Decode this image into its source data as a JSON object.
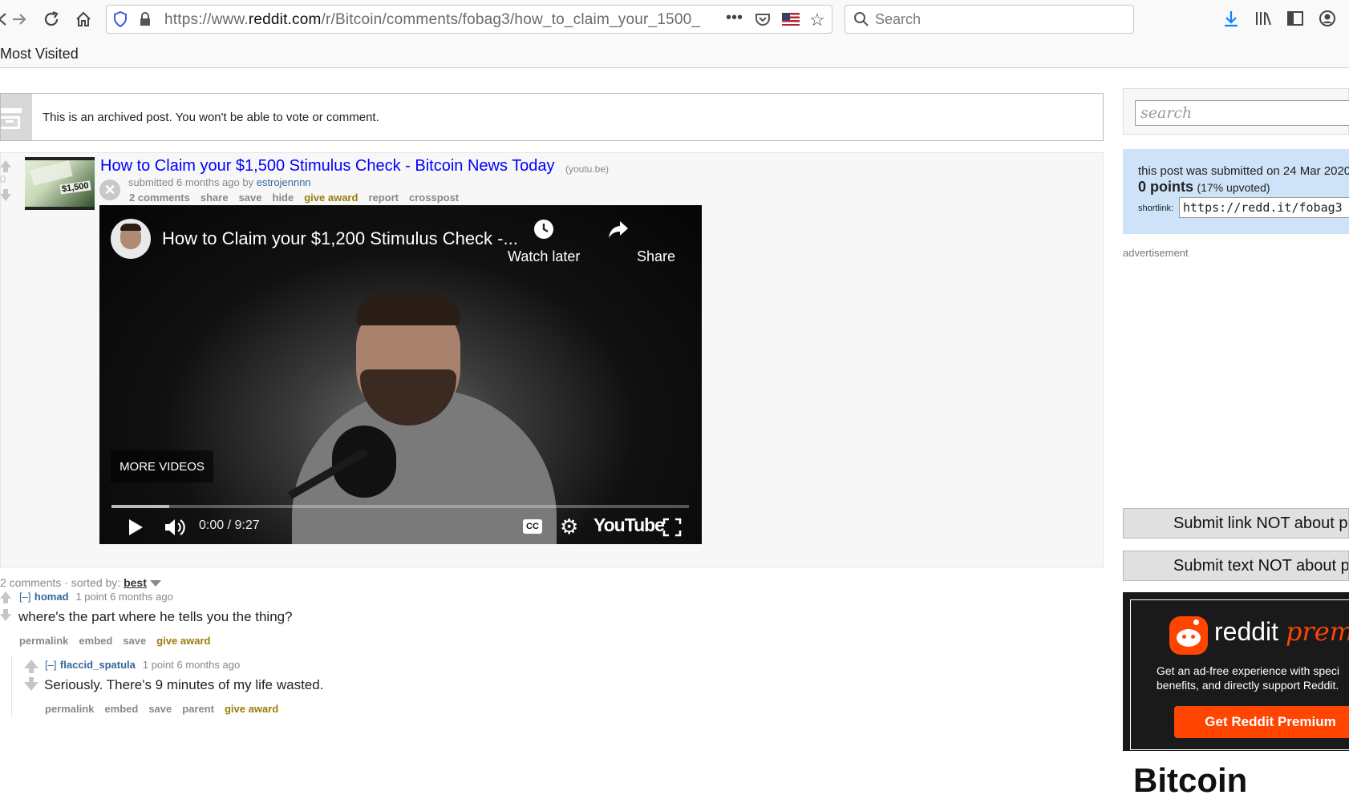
{
  "browser": {
    "url_prefix": "https://www.",
    "url_domain": "reddit.com",
    "url_path": "/r/Bitcoin/comments/fobag3/how_to_claim_your_1500_",
    "search_placeholder": "Search",
    "bookmarks_folder": "Most Visited",
    "icons": [
      "back-icon",
      "forward-icon",
      "reload-icon",
      "home-icon",
      "shield-icon",
      "lock-icon",
      "more-icon",
      "pocket-icon",
      "flag-icon",
      "star-icon",
      "search-icon",
      "download-icon",
      "library-icon",
      "sidebar-icon",
      "account-icon"
    ]
  },
  "archived_notice": "This is an archived post. You won't be able to vote or comment.",
  "post": {
    "score": "0",
    "title": "How to Claim your $1,500 Stimulus Check - Bitcoin News Today",
    "domain": "(youtu.be)",
    "tagline_prefix": "submitted 6 months ago by",
    "author": "estrojennnn",
    "buttons": [
      "2 comments",
      "share",
      "save",
      "hide",
      "give award",
      "report",
      "crosspost"
    ],
    "thumbnail_text": "$1,500"
  },
  "video": {
    "title": "How to Claim your $1,200 Stimulus Check -...",
    "watch_later": "Watch later",
    "share": "Share",
    "more_videos": "MORE VIDEOS",
    "time": "0:00 / 9:27",
    "progress": 0.1,
    "logo": "YouTube"
  },
  "comments": {
    "header_count": "2 comments",
    "sorted_by_label": "sorted by:",
    "sort_value": "best",
    "items": [
      {
        "collapse": "[–]",
        "author": "homad",
        "meta": "1 point 6 months ago",
        "body": "where's the part where he tells you the thing?",
        "buttons": [
          "permalink",
          "embed",
          "save",
          "give award"
        ]
      },
      {
        "collapse": "[–]",
        "author": "flaccid_spatula",
        "meta": "1 point 6 months ago",
        "body": "Seriously. There's 9 minutes of my life wasted.",
        "buttons": [
          "permalink",
          "embed",
          "save",
          "parent",
          "give award"
        ]
      }
    ]
  },
  "sidebar": {
    "search_placeholder": "search",
    "submitted_text": "this post was submitted on 24 Mar 2020",
    "points": "0 points",
    "upvoted": "(17% upvoted)",
    "shortlink_label": "shortlink:",
    "shortlink": "https://redd.it/fobag3",
    "ad_label": "advertisement",
    "submit_link": "Submit link NOT about p",
    "submit_text": "Submit text NOT about p",
    "premium_logo": "reddit",
    "premium_logo_suffix": "premi",
    "premium_text_1": "Get an ad-free experience with speci",
    "premium_text_2": "benefits, and directly support Reddit.",
    "premium_button": "Get Reddit Premium",
    "subreddit": "Bitcoin"
  },
  "colors": {
    "link_blue": "#0000ff",
    "author_blue": "#336699",
    "award_gold": "#9a7d0a",
    "premium_orange": "#ff4500",
    "sidebar_blue": "#cee3f8"
  }
}
